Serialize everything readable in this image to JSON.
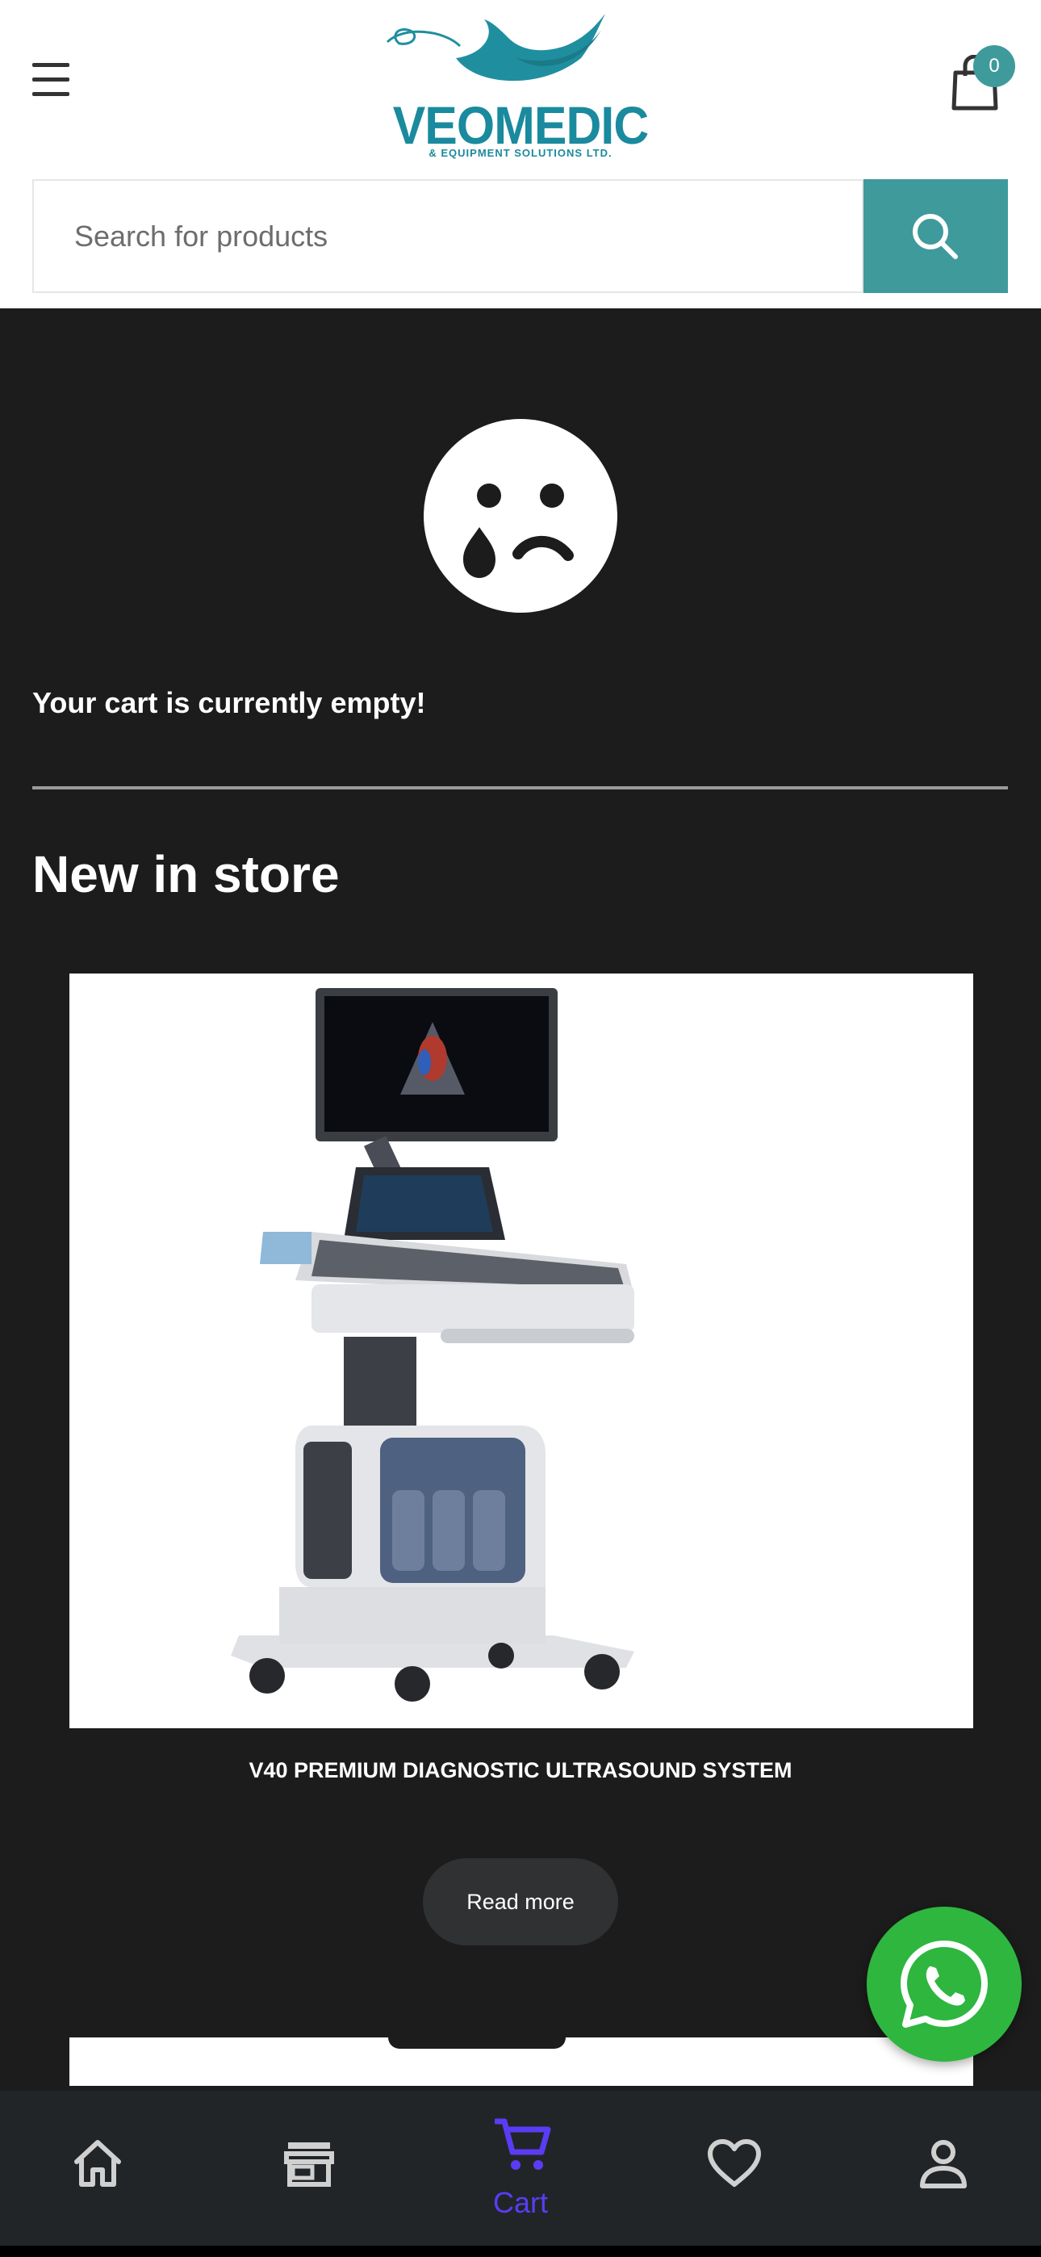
{
  "header": {
    "logo_text": "VEOMEDIC",
    "logo_subtext": "& EQUIPMENT SOLUTIONS LTD.",
    "cart_count": "0"
  },
  "search": {
    "placeholder": "Search for products"
  },
  "cart": {
    "empty_message": "Your cart is currently empty!"
  },
  "new_in_store": {
    "title": "New in store",
    "products": [
      {
        "name": "V40 PREMIUM DIAGNOSTIC ULTRASOUND SYSTEM",
        "cta": "Read more"
      }
    ]
  },
  "bottom_nav": {
    "items": [
      {
        "icon": "home-icon",
        "label": ""
      },
      {
        "icon": "store-icon",
        "label": ""
      },
      {
        "icon": "cart-icon",
        "label": "Cart",
        "active": true
      },
      {
        "icon": "heart-icon",
        "label": ""
      },
      {
        "icon": "user-icon",
        "label": ""
      }
    ]
  },
  "colors": {
    "accent": "#3f9a9b",
    "brand": "#1a8a9e",
    "background": "#1c1c1d",
    "nav_active": "#5b3cf5",
    "whatsapp": "#2eb63f"
  }
}
